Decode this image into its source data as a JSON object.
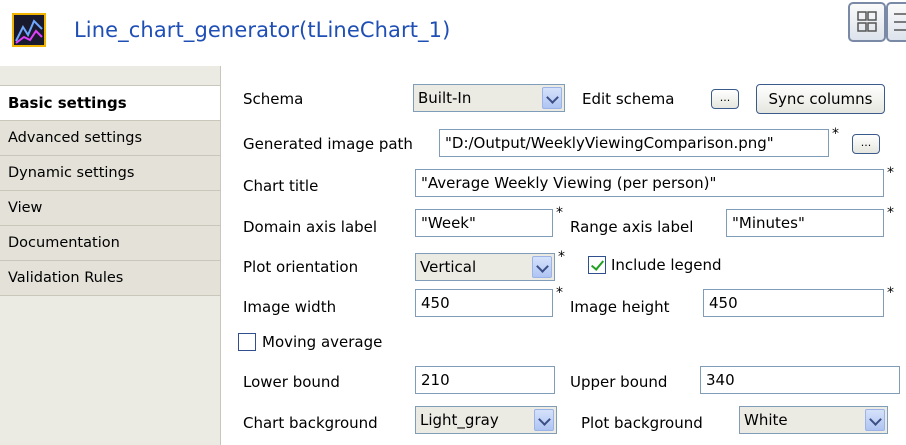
{
  "header": {
    "title": "Line_chart_generator(tLineChart_1)",
    "icon": "line-chart-icon",
    "buttons": [
      "grid-view-icon",
      "list-view-icon"
    ]
  },
  "sidebar": {
    "items": [
      {
        "label": "Basic settings",
        "active": true
      },
      {
        "label": "Advanced settings"
      },
      {
        "label": "Dynamic settings"
      },
      {
        "label": "View"
      },
      {
        "label": "Documentation"
      },
      {
        "label": "Validation Rules"
      }
    ]
  },
  "form": {
    "schema_label": "Schema",
    "schema_value": "Built-In",
    "edit_schema_label": "Edit schema",
    "edit_schema_button": "...",
    "sync_columns_button": "Sync columns",
    "image_path_label": "Generated image path",
    "image_path_value": "\"D:/Output/WeeklyViewingComparison.png\"",
    "image_path_button": "...",
    "chart_title_label": "Chart title",
    "chart_title_value": "\"Average Weekly Viewing (per person)\"",
    "domain_axis_label": "Domain axis label",
    "domain_axis_value": "\"Week\"",
    "range_axis_label": "Range axis label",
    "range_axis_value": "\"Minutes\"",
    "orientation_label": "Plot orientation",
    "orientation_value": "Vertical",
    "include_legend_label": "Include legend",
    "include_legend_checked": true,
    "image_width_label": "Image width",
    "image_width_value": "450",
    "image_height_label": "Image height",
    "image_height_value": "450",
    "moving_average_label": "Moving average",
    "moving_average_checked": false,
    "lower_bound_label": "Lower bound",
    "lower_bound_value": "210",
    "upper_bound_label": "Upper bound",
    "upper_bound_value": "340",
    "chart_bg_label": "Chart background",
    "chart_bg_value": "Light_gray",
    "plot_bg_label": "Plot background",
    "plot_bg_value": "White",
    "required_mark": "*"
  },
  "colors": {
    "title": "#1f4fb5",
    "sidebar_bg": "#ecebe3",
    "field_border": "#7f9db9"
  }
}
